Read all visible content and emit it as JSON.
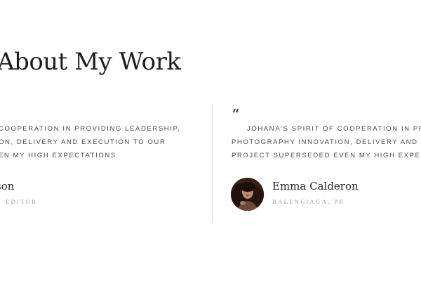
{
  "section": {
    "title": "About My Work"
  },
  "testimonials": [
    {
      "quote_lines": [
        "COOPERATION IN PROVIDING LEADERSHIP,",
        "ON, DELIVERY AND EXECUTION TO OUR",
        "EN MY HIGH EXPECTATIONS"
      ],
      "name": "son",
      "role": "EDITOR"
    },
    {
      "quote_mark": "“",
      "quote_lines": [
        "JOHANA'S SPIRIT OF COOPERATION IN PROV",
        "PHOTOGRAPHY INNOVATION, DELIVERY AND EX",
        "PROJECT SUPERSEDED EVEN MY HIGH EXPECTAT"
      ],
      "name": "Emma Calderon",
      "role": "BALENCIAGA, PR"
    }
  ],
  "colors": {
    "text_dark": "#1e1e1e",
    "text_body": "#4a4a4a",
    "text_muted": "#9a9a9a",
    "divider": "#e4e4e4",
    "background": "#ffffff"
  }
}
